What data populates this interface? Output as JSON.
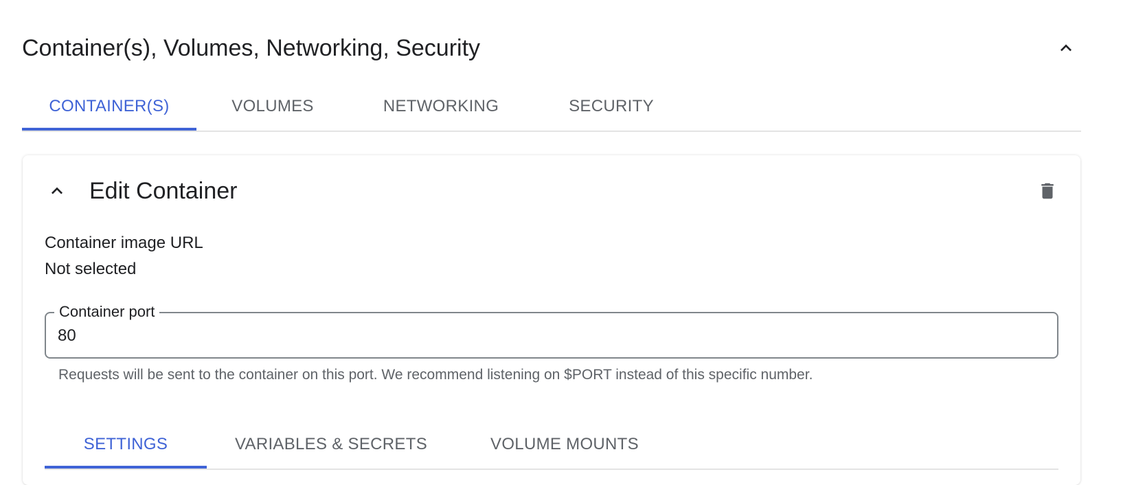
{
  "section": {
    "title": "Container(s), Volumes, Networking, Security",
    "collapse_icon": "chevron-up-icon"
  },
  "tabs": [
    {
      "label": "CONTAINER(S)",
      "active": true
    },
    {
      "label": "VOLUMES",
      "active": false
    },
    {
      "label": "NETWORKING",
      "active": false
    },
    {
      "label": "SECURITY",
      "active": false
    }
  ],
  "container_card": {
    "title": "Edit Container",
    "toggle_icon": "chevron-up-icon",
    "delete_icon": "trash-icon",
    "image_url": {
      "label": "Container image URL",
      "value": "Not selected"
    },
    "port": {
      "label": "Container port",
      "value": "80",
      "helper": "Requests will be sent to the container on this port. We recommend listening on $PORT instead of this specific number."
    },
    "subtabs": [
      {
        "label": "SETTINGS",
        "active": true
      },
      {
        "label": "VARIABLES & SECRETS",
        "active": false
      },
      {
        "label": "VOLUME MOUNTS",
        "active": false
      }
    ]
  },
  "colors": {
    "accent": "#3f63d6",
    "text": "#202124",
    "secondary_text": "#5f6368",
    "divider": "#e3e3e3"
  }
}
